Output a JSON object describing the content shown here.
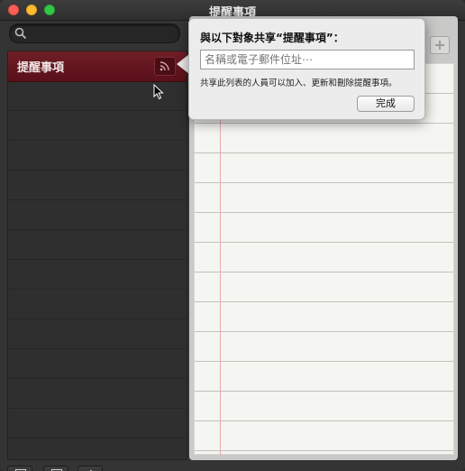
{
  "window": {
    "title": "提醒事項"
  },
  "sidebar": {
    "search": {
      "icon": "search-icon",
      "value": ""
    },
    "lists": [
      {
        "label": "提醒事項",
        "selected": true,
        "share_icon": "share-icon"
      }
    ],
    "bottom_buttons": [
      {
        "icon": "show-sidebar-icon"
      },
      {
        "icon": "calendar-icon"
      },
      {
        "icon": "plus-icon"
      }
    ]
  },
  "share_popover": {
    "heading": "與以下對象共享“提醒事項”：",
    "input_placeholder": "名稱或電子郵件位址⋯",
    "input_value": "",
    "description": "共享此列表的人員可以加入、更新和刪除提醒事項。",
    "done_label": "完成"
  },
  "pane": {
    "add_icon": "plus-icon"
  },
  "colors": {
    "selected_list": "#6a1a22",
    "paper": "#f5f5f1",
    "margin_line": "#e8aab0"
  }
}
